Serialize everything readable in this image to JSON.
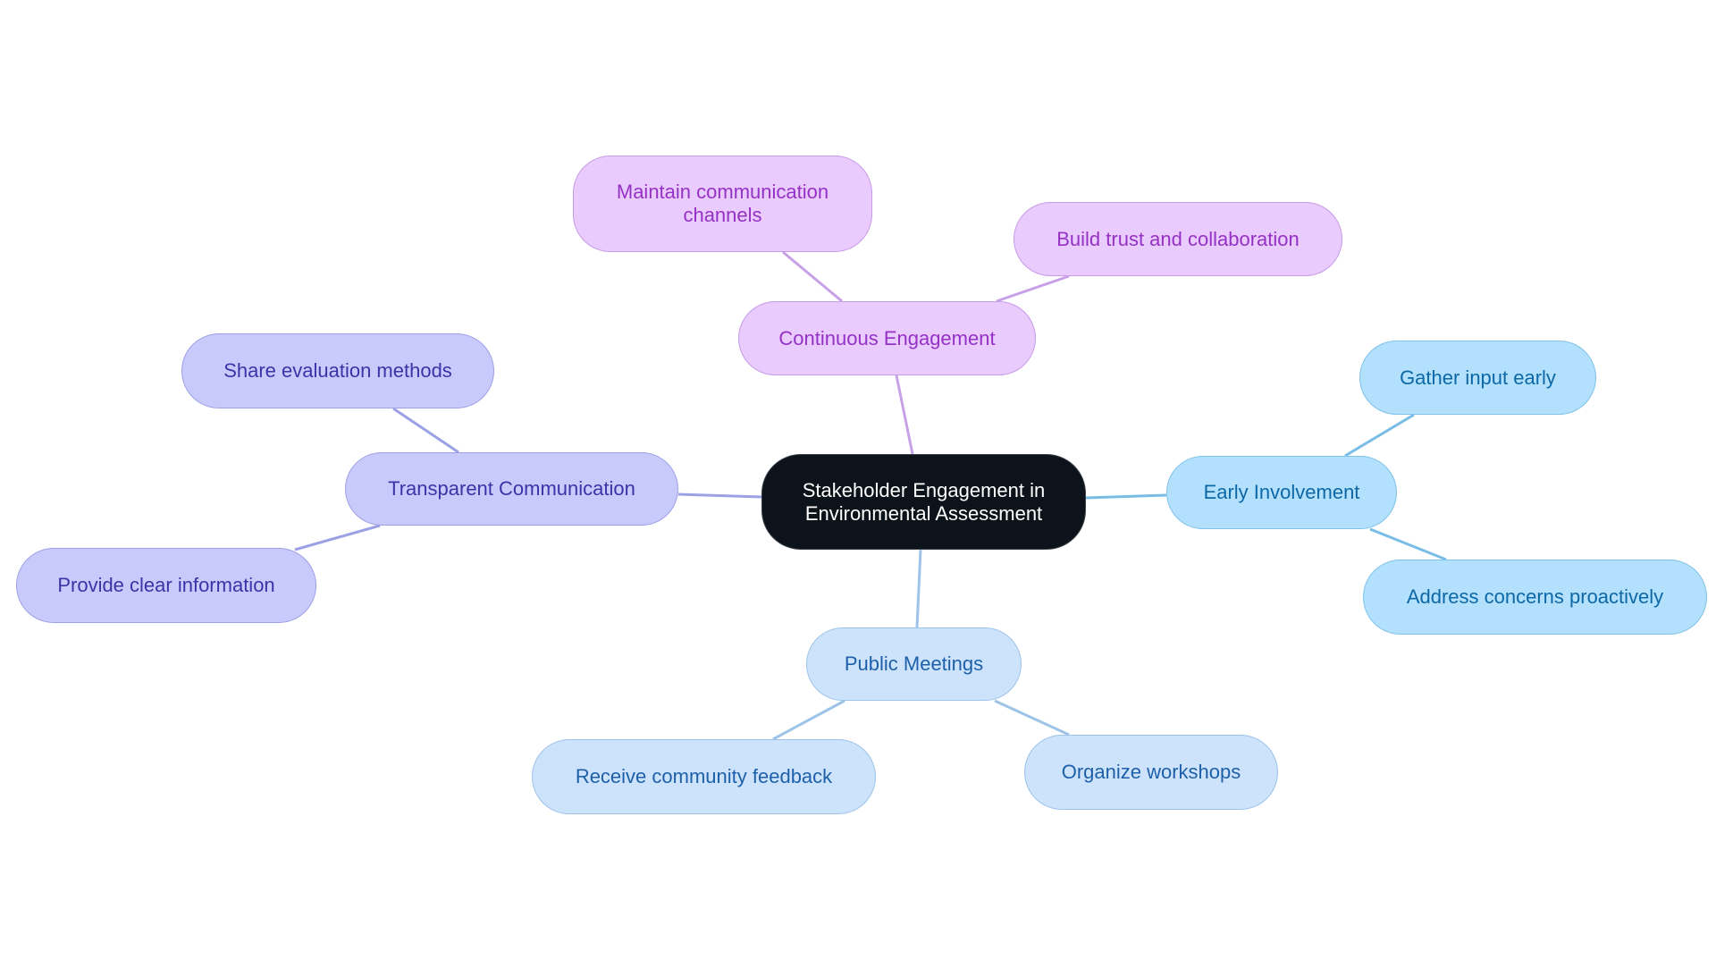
{
  "title": "Stakeholder Engagement in Environmental Assessment",
  "colors": {
    "root": "#0c131a",
    "continuous_engagement_branch": "#c8a0e8",
    "transparent_communication_branch": "#9ca0e4",
    "early_involvement_branch": "#79bde6",
    "public_meetings_branch": "#9dc3e8"
  },
  "root": {
    "label_line1": "Stakeholder Engagement in",
    "label_line2": "Environmental Assessment"
  },
  "branches": {
    "continuous_engagement": {
      "label": "Continuous Engagement",
      "children": [
        {
          "label_line1": "Maintain communication",
          "label_line2": "channels"
        },
        {
          "label": "Build trust and collaboration"
        }
      ]
    },
    "early_involvement": {
      "label": "Early Involvement",
      "children": [
        {
          "label": "Gather input early"
        },
        {
          "label": "Address concerns proactively"
        }
      ]
    },
    "public_meetings": {
      "label": "Public Meetings",
      "children": [
        {
          "label": "Receive community feedback"
        },
        {
          "label": "Organize workshops"
        }
      ]
    },
    "transparent_communication": {
      "label": "Transparent Communication",
      "children": [
        {
          "label": "Share evaluation methods"
        },
        {
          "label": "Provide clear information"
        }
      ]
    }
  }
}
